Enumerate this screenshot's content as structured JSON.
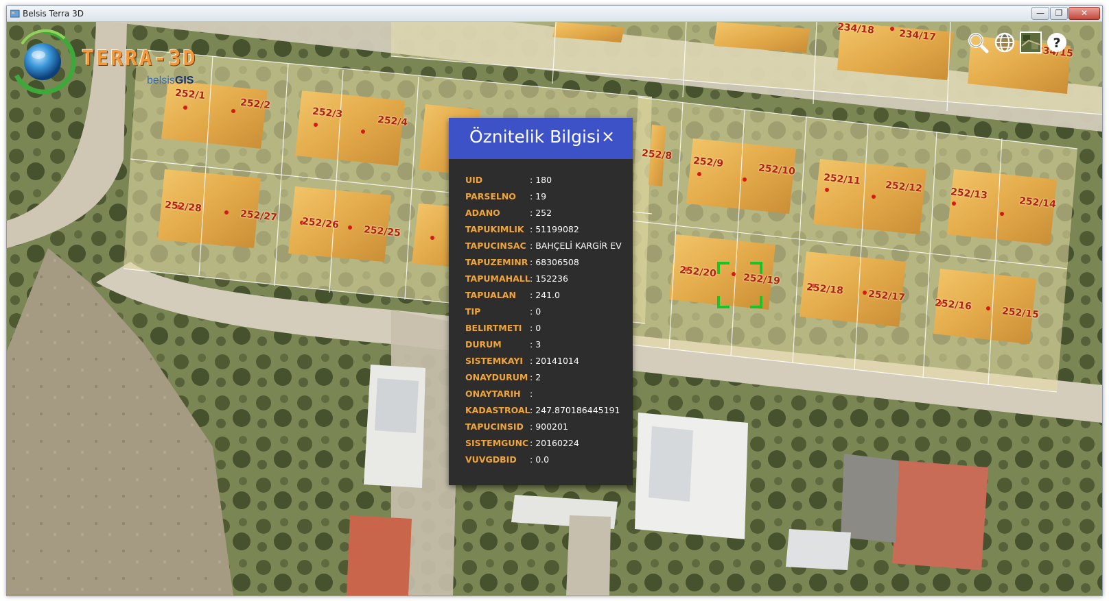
{
  "window": {
    "title": "Belsis Terra 3D",
    "minimize": "—",
    "maximize": "❐",
    "close": "✕"
  },
  "logo": {
    "brand": "TERRA-3D",
    "sub_prefix": "belsis",
    "sub_suffix": "GIS"
  },
  "toolbar": [
    {
      "name": "search-icon",
      "label": "Search"
    },
    {
      "name": "globe-icon",
      "label": "Globe"
    },
    {
      "name": "map-layer-icon",
      "label": "Layers"
    },
    {
      "name": "help-icon",
      "label": "Help"
    }
  ],
  "parcels": [
    "252/1",
    "252/2",
    "252/3",
    "252/4",
    "252/28",
    "252/27",
    "252/26",
    "252/25",
    "252/9",
    "252/10",
    "252/11",
    "252/12",
    "252/13",
    "252/14",
    "252/20",
    "252/19",
    "252/18",
    "252/17",
    "252/16",
    "252/15",
    "252/8",
    "234/18",
    "234/17",
    "234/15"
  ],
  "popup": {
    "title": "Öznitelik Bilgisi",
    "close_icon": "×",
    "attributes": [
      {
        "key": "UID",
        "value": "180"
      },
      {
        "key": "PARSELNO",
        "value": "19"
      },
      {
        "key": "ADANO",
        "value": "252"
      },
      {
        "key": "TAPUKIMLIK",
        "value": "51199082"
      },
      {
        "key": "TAPUCINSAC",
        "value": "BAHÇELİ KARGİR EV"
      },
      {
        "key": "TAPUZEMINR",
        "value": "68306508"
      },
      {
        "key": "TAPUMAHALL",
        "value": "152236"
      },
      {
        "key": "TAPUALAN",
        "value": "241.0"
      },
      {
        "key": "TIP",
        "value": "0"
      },
      {
        "key": "BELIRTMETI",
        "value": "0"
      },
      {
        "key": "DURUM",
        "value": "3"
      },
      {
        "key": "SISTEMKAYI",
        "value": "20141014"
      },
      {
        "key": "ONAYDURUM",
        "value": "2"
      },
      {
        "key": "ONAYTARIH",
        "value": ""
      },
      {
        "key": "KADASTROAL",
        "value": "247.870186445191"
      },
      {
        "key": "TAPUCINSID",
        "value": "900201"
      },
      {
        "key": "SISTEMGUNC",
        "value": "20160224"
      },
      {
        "key": "VUVGDBID",
        "value": "0.0"
      }
    ]
  },
  "colors": {
    "popup_header": "#3e52c8",
    "popup_body": "#2d2d2d",
    "attr_key": "#f0a53c",
    "parcel_label": "#b4200f",
    "selection": "#18c428"
  }
}
